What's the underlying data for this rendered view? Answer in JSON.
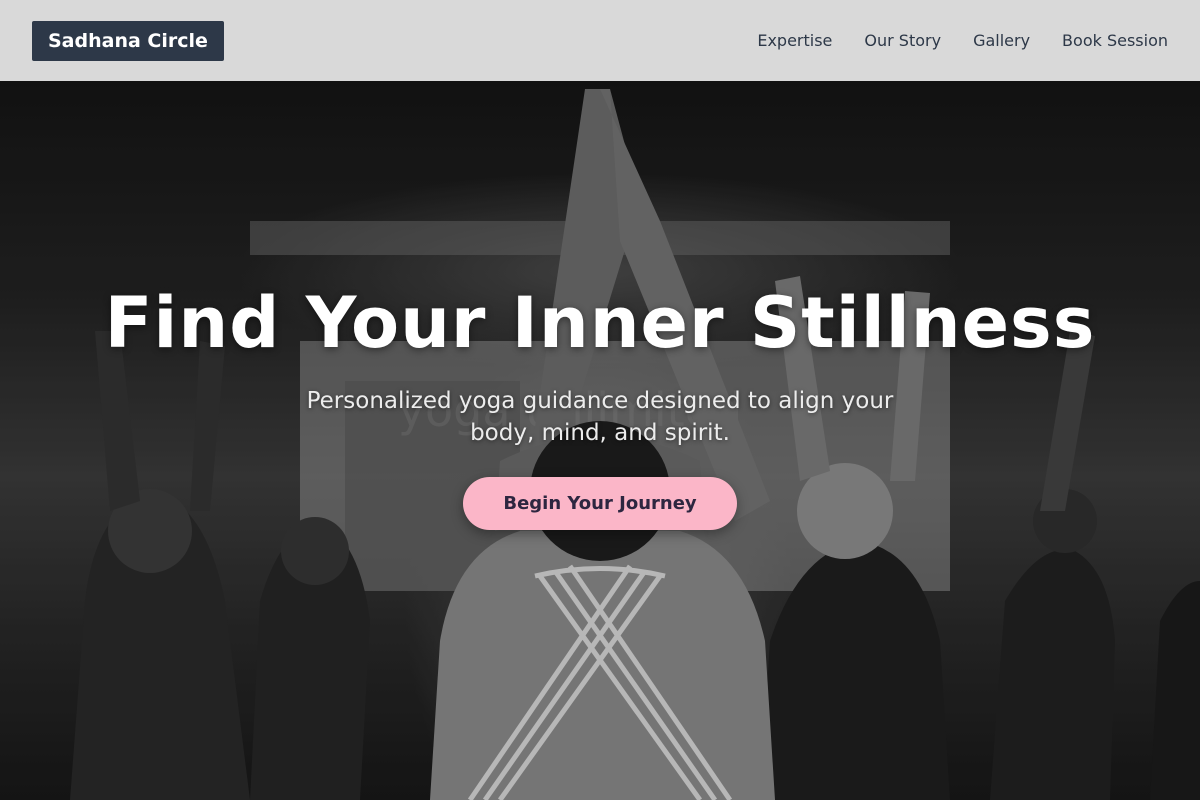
{
  "header": {
    "brand": "Sadhana Circle",
    "nav": [
      {
        "label": "Expertise"
      },
      {
        "label": "Our Story"
      },
      {
        "label": "Gallery"
      },
      {
        "label": "Book Session"
      }
    ]
  },
  "hero": {
    "title": "Find Your Inner Stillness",
    "subtitle": "Personalized yoga guidance designed to align your body, mind, and spirit.",
    "cta_label": "Begin Your Journey",
    "background_description_icon": "yoga-class-photo",
    "background_sign_text": "yoga unlimited"
  },
  "colors": {
    "header_bg": "#d9d9d9",
    "brand_bg": "#2d3848",
    "nav_text": "#2d3848",
    "cta_bg": "#fbb6c8",
    "cta_text": "#2d2640"
  }
}
